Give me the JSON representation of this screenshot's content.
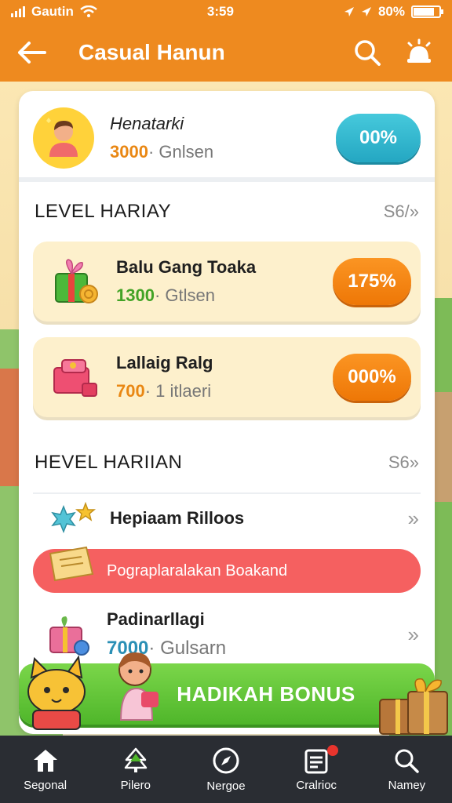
{
  "status_bar": {
    "carrier": "Gautin",
    "time": "3:59",
    "battery": "80%",
    "battery_level": 0.8
  },
  "header": {
    "title": "Casual Hanun"
  },
  "profile": {
    "name": "Henatarki",
    "amount": "3000",
    "unit": "Gnlsen",
    "badge": "00%"
  },
  "level_section": {
    "label": "LEVEL HARIAY",
    "more": "S6/»",
    "items": [
      {
        "name": "Balu Gang Toaka",
        "amount": "1300",
        "unit": "Gtlsen",
        "badge": "175%"
      },
      {
        "name": "Lallaig Ralg",
        "amount": "700",
        "unit": "1 itlaeri",
        "badge": "000%"
      }
    ]
  },
  "daily_section": {
    "label": "HEVEL HARIIAN",
    "more": "S6»",
    "row1": {
      "name": "Hepiaam Rilloos"
    },
    "red_bar": {
      "text": "Pograplaralakan Boakand"
    },
    "row2": {
      "name": "Padinarllagi",
      "amount": "7000",
      "unit": "Gulsarn"
    }
  },
  "bonus": {
    "label": "HADIKAH BONUS"
  },
  "nav": {
    "items": [
      {
        "label": "Segonal",
        "icon": "home-icon"
      },
      {
        "label": "Pilero",
        "icon": "tree-icon"
      },
      {
        "label": "Nergoe",
        "icon": "compass-icon"
      },
      {
        "label": "Cralrioc",
        "icon": "list-icon"
      },
      {
        "label": "Namey",
        "icon": "search-icon"
      }
    ]
  },
  "colors": {
    "header": "#ee8a1f",
    "teal": "#2ab4cc",
    "orange_pill": "#f48712",
    "red_bar": "#f56060",
    "bonus_green": "#5cc233",
    "nav_bg": "#2a2d33"
  }
}
